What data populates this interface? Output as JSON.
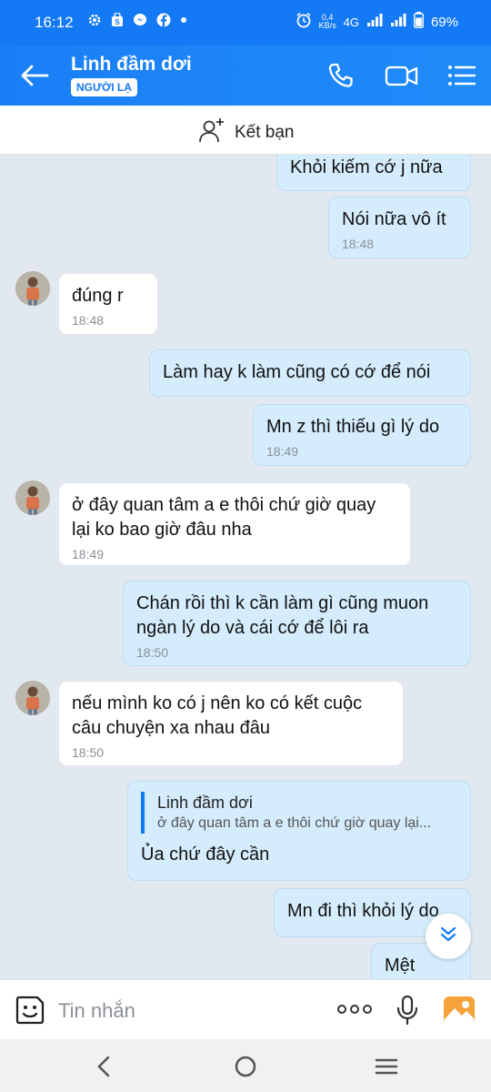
{
  "status": {
    "time": "16:12",
    "net_speed_value": "0,4",
    "net_speed_unit": "KB/s",
    "network": "4G",
    "battery": "69%"
  },
  "header": {
    "title": "Linh đầm dơi",
    "badge": "NGƯỜI LẠ",
    "accent": "#1479f5"
  },
  "friend_bar": {
    "label": "Kết bạn"
  },
  "messages": [
    {
      "side": "me",
      "text": "Khỏi kiếm cớ j nữa",
      "time": ""
    },
    {
      "side": "me",
      "text": "Nói nữa vô ít",
      "time": "18:48"
    },
    {
      "side": "them",
      "text": "đúng r",
      "time": "18:48"
    },
    {
      "side": "me",
      "text": "Làm hay k làm cũng có cớ để nói",
      "time": ""
    },
    {
      "side": "me",
      "text": "Mn z thì thiếu gì lý do",
      "time": "18:49"
    },
    {
      "side": "them",
      "text": "ở đây quan tâm a e thôi chứ giờ quay lại ko bao giờ đâu nha",
      "time": "18:49"
    },
    {
      "side": "me",
      "text": "Chán rồi thì k cần làm gì cũng muon ngàn lý do và cái cớ để lôi ra",
      "time": "18:50"
    },
    {
      "side": "them",
      "text": "nếu mình ko có j nên ko có kết cuộc câu chuyện xa nhau đâu",
      "time": "18:50"
    },
    {
      "side": "me",
      "text": "Ủa chứ đây cần",
      "time": "",
      "quote_name": "Linh đầm dơi",
      "quote_text": "ở đây quan tâm a e thôi chứ giờ quay lại..."
    },
    {
      "side": "me",
      "text": "Mn đi thì khỏi lý do",
      "time": ""
    },
    {
      "side": "me",
      "text": "Mệt",
      "time": ""
    }
  ],
  "input": {
    "placeholder": "Tin nhắn"
  },
  "icons": {
    "back": "arrow-left-icon",
    "call": "phone-icon",
    "video": "video-camera-icon",
    "menu": "list-menu-icon",
    "add_friend": "add-user-icon",
    "sticker": "sticker-icon",
    "more": "more-dots-icon",
    "mic": "microphone-icon",
    "image": "image-icon"
  }
}
